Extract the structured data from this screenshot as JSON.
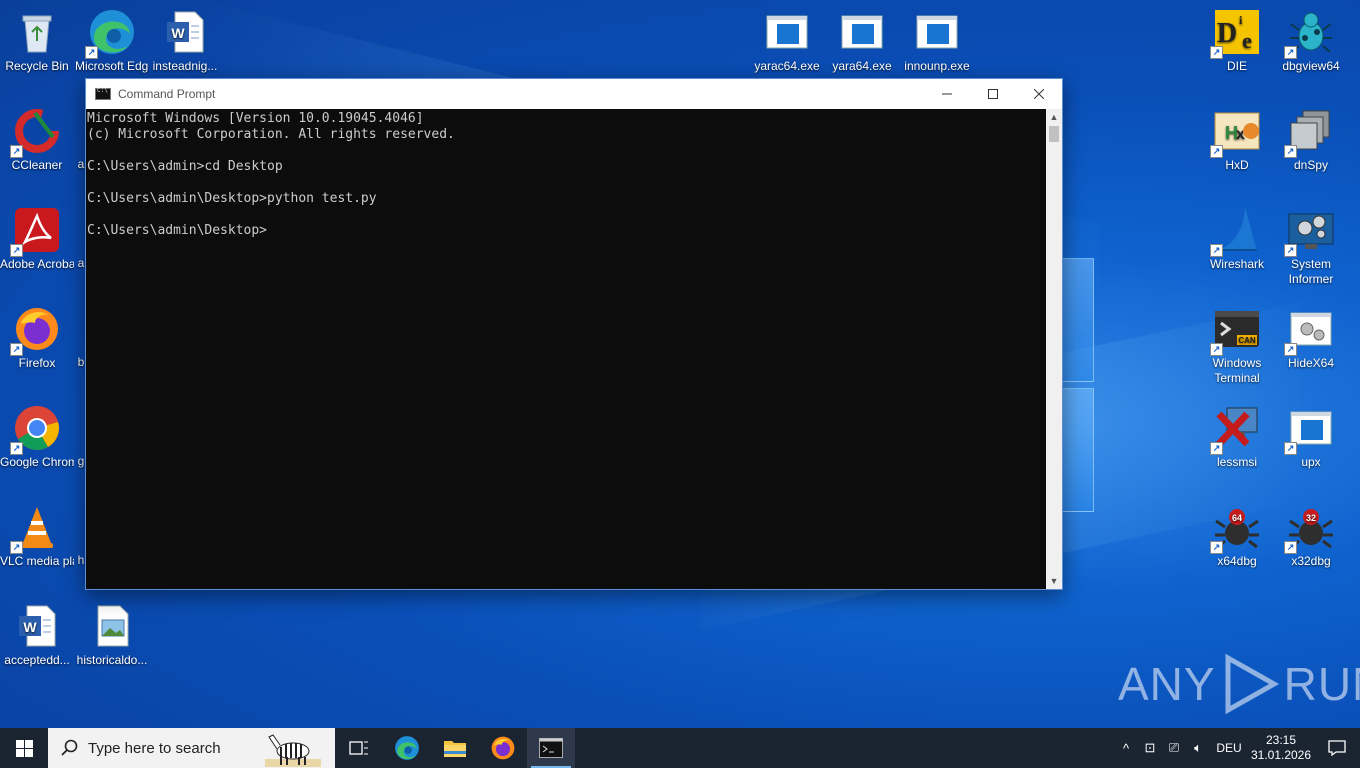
{
  "desktop": {
    "left_icons": [
      {
        "label": "Recycle Bin",
        "icon": "recycle-bin-icon"
      },
      {
        "label": "Microsoft Edge",
        "icon": "edge-icon"
      },
      {
        "label": "insteadnig...",
        "icon": "word-doc-icon"
      },
      {
        "label": "CCleaner",
        "icon": "ccleaner-icon"
      },
      {
        "label": "Adobe Acrobat",
        "icon": "acrobat-icon"
      },
      {
        "label": "Firefox",
        "icon": "firefox-icon"
      },
      {
        "label": "Google Chrome",
        "icon": "chrome-icon"
      },
      {
        "label": "VLC media player",
        "icon": "vlc-icon"
      },
      {
        "label": "acceptedd...",
        "icon": "word-doc-icon"
      },
      {
        "label": "historicaldo...",
        "icon": "image-file-icon"
      }
    ],
    "top_icons": [
      {
        "label": "yarac64.exe",
        "icon": "exe-window-icon"
      },
      {
        "label": "yara64.exe",
        "icon": "exe-window-icon"
      },
      {
        "label": "innounp.exe",
        "icon": "exe-window-icon"
      }
    ],
    "right_icons": [
      {
        "label": "DIE",
        "icon": "die-icon"
      },
      {
        "label": "dbgview64",
        "icon": "dbgview-icon"
      },
      {
        "label": "HxD",
        "icon": "hxd-icon"
      },
      {
        "label": "dnSpy",
        "icon": "dnspy-icon"
      },
      {
        "label": "Wireshark",
        "icon": "wireshark-icon"
      },
      {
        "label": "System Informer",
        "icon": "system-informer-icon"
      },
      {
        "label": "Windows Terminal",
        "icon": "windows-terminal-icon"
      },
      {
        "label": "HideX64",
        "icon": "hidex64-icon"
      },
      {
        "label": "lessmsi",
        "icon": "lessmsi-icon"
      },
      {
        "label": "upx",
        "icon": "exe-window-icon"
      },
      {
        "label": "x64dbg",
        "icon": "x64dbg-icon"
      },
      {
        "label": "x32dbg",
        "icon": "x32dbg-icon"
      }
    ],
    "partial_letters": [
      "a",
      "a",
      "b",
      "g",
      "h"
    ]
  },
  "cmd_window": {
    "title": "Command Prompt",
    "lines": [
      "Microsoft Windows [Version 10.0.19045.4046]",
      "(c) Microsoft Corporation. All rights reserved.",
      "",
      "C:\\Users\\admin>cd Desktop",
      "",
      "C:\\Users\\admin\\Desktop>python test.py",
      "",
      "C:\\Users\\admin\\Desktop>"
    ]
  },
  "taskbar": {
    "search_placeholder": "Type here to search",
    "language": "DEU",
    "time": "23:15",
    "date": "31.01.2026"
  },
  "watermark": {
    "text_left": "ANY",
    "text_right": "RUN"
  },
  "colors": {
    "console_bg": "#0c0c0c",
    "console_fg": "#cccccc",
    "taskbar_bg": "#1b2431",
    "desktop_blue": "#0a4fb8"
  }
}
